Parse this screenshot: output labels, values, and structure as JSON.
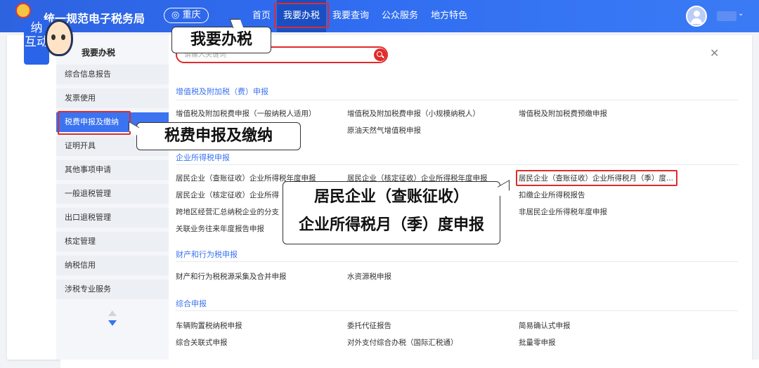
{
  "header": {
    "brand": "统一规范电子税务局",
    "region": "重庆",
    "nav": [
      {
        "label": "首页"
      },
      {
        "label": "我要办税"
      },
      {
        "label": "我要查询"
      },
      {
        "label": "公众服务"
      },
      {
        "label": "地方特色"
      }
    ]
  },
  "mascot": {
    "tag": "纳\n互动"
  },
  "search": {
    "placeholder": "请输入关键词"
  },
  "sidebar": {
    "title": "我要办税",
    "items": [
      {
        "label": "综合信息报告"
      },
      {
        "label": "发票使用"
      },
      {
        "label": "税费申报及缴纳"
      },
      {
        "label": "证明开具"
      },
      {
        "label": "其他事项申请"
      },
      {
        "label": "一般退税管理"
      },
      {
        "label": "出口退税管理"
      },
      {
        "label": "核定管理"
      },
      {
        "label": "纳税信用"
      },
      {
        "label": "涉税专业服务"
      }
    ]
  },
  "sections": [
    {
      "title": "增值税及附加税（费）申报",
      "links": [
        "增值税及附加税费申报（一般纳税人适用）",
        "增值税及附加税费申报（小规模纳税人）",
        "增值税及附加税费预缴申报",
        "原油天然气增值税申报"
      ]
    },
    {
      "title": "企业所得税申报",
      "links": [
        "居民企业（查账征收）企业所得税年度申报",
        "居民企业（核定征收）企业所得税年度申报",
        "居民企业（查账征收）企业所得税月（季）度...",
        "居民企业（核定征收）企业所得",
        "扣缴企业所得税报告",
        "跨地区经营汇总纳税企业的分支",
        "非居民企业所得税年度申报",
        "关联业务往来年度报告申报"
      ]
    },
    {
      "title": "财产和行为税申报",
      "links": [
        "财产和行为税税源采集及合并申报",
        "水资源税申报"
      ]
    },
    {
      "title": "综合申报",
      "links": [
        "车辆购置税纳税申报",
        "委托代征报告",
        "简易确认式申报",
        "综合关联式申报",
        "对外支付综合办税（国际汇税通）",
        "批量零申报"
      ]
    }
  ],
  "callouts": {
    "c1": "我要办税",
    "c2": "税费申报及缴纳",
    "c3_line1": "居民企业（查账征收）",
    "c3_line2": "企业所得税月（季）度申报"
  },
  "colors": {
    "accent": "#3b73f0",
    "highlight": "#e02b2b",
    "topbar": "#2f6bf0"
  }
}
